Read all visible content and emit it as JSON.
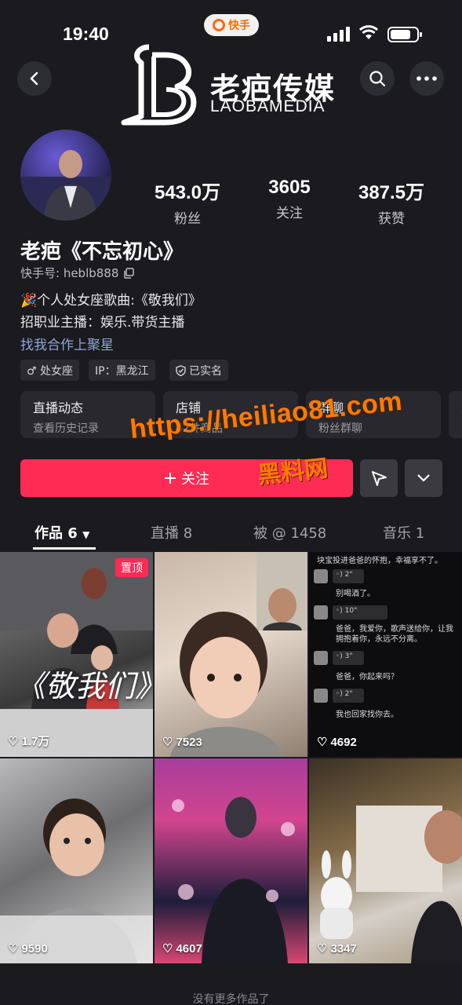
{
  "status_bar": {
    "time": "19:40",
    "app_badge": "快手"
  },
  "header": {
    "logo_cn": "老疤传媒",
    "logo_en": "LAOBAMEDIA",
    "back_icon": "chevron-left-icon",
    "search_icon": "search-icon",
    "more_icon": "more-horizontal-icon"
  },
  "profile": {
    "stats": [
      {
        "value": "543.0万",
        "label": "粉丝"
      },
      {
        "value": "3605",
        "label": "关注"
      },
      {
        "value": "387.5万",
        "label": "获赞"
      }
    ],
    "name": "老疤《不忘初心》",
    "kuaishou_id": "快手号: heblb888",
    "bio_line1": "🎉个人处女座歌曲:《敬我们》",
    "bio_line2": "招职业主播：娱乐.带货主播",
    "bio_line3": "找我合作上聚星",
    "tags": [
      "♂ 处女座",
      "IP：黑龙江",
      "已实名"
    ]
  },
  "features": [
    {
      "title": "直播动态",
      "sub": "查看历史记录"
    },
    {
      "title": "店铺",
      "sub": "42件商品"
    },
    {
      "title": "群聊",
      "sub": "粉丝群聊"
    },
    {
      "title": "更",
      "sub": ""
    }
  ],
  "actions": {
    "follow_label": "关注",
    "follow_icon": "plus-icon",
    "share_icon": "send-icon",
    "expand_icon": "chevron-down-icon"
  },
  "watermark": {
    "url": "https://heiliao81.com",
    "name": "黑料网"
  },
  "tabs": [
    {
      "label": "作品 6"
    },
    {
      "label": "直播 8"
    },
    {
      "label": "被 @ 1458"
    },
    {
      "label": "音乐 1"
    }
  ],
  "videos": [
    {
      "likes": "1.7万",
      "pinned": "置顶",
      "cover_text": "《敬我们》"
    },
    {
      "likes": "7523"
    },
    {
      "likes": "4692"
    },
    {
      "likes": "9590"
    },
    {
      "likes": "4607"
    },
    {
      "likes": "3347"
    }
  ],
  "chat_lines": [
    "块宝投进爸爸的怀抱，幸福享不了。",
    "别喝酒了。",
    "爸爸，我爱你，歌声送给你，让我拥抱着你，永远不分离。",
    "爸爸，你起来吗？",
    "我也回家找你去。"
  ],
  "footer": "没有更多作品了"
}
